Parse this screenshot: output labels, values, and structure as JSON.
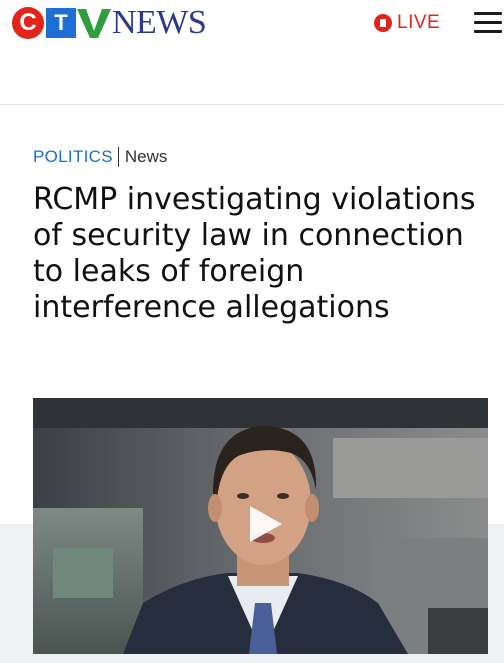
{
  "header": {
    "logo": {
      "c": "C",
      "t": "T",
      "v": "V",
      "news": "NEWS"
    },
    "live_label": "LIVE",
    "live_icon": "lock-icon",
    "menu_icon": "hamburger-menu-icon",
    "accent_color": "#e1251b",
    "brand_blue": "#1d6fd6"
  },
  "article": {
    "section": "POLITICS",
    "subsection": "News",
    "headline": "RCMP investigating violations of security law in connection to leaks of foreign interference allegations"
  },
  "media": {
    "type": "video",
    "play_icon": "play-icon"
  }
}
